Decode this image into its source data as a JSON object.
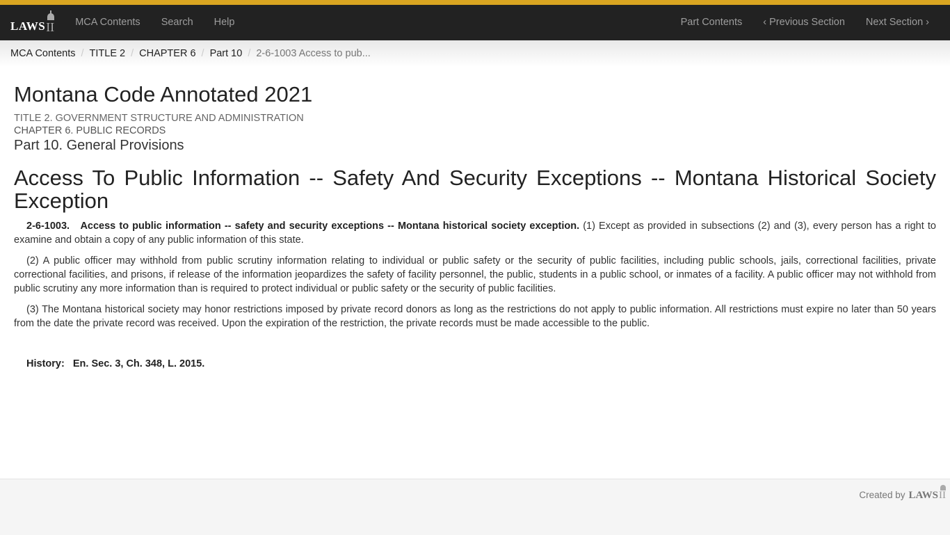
{
  "colors": {
    "accent": "#d9a521",
    "navbar": "#222222"
  },
  "navbar": {
    "logo": "LAWS",
    "left_links": [
      "MCA Contents",
      "Search",
      "Help"
    ],
    "right_links": [
      "Part Contents",
      "‹ Previous Section",
      "Next Section ›"
    ]
  },
  "breadcrumb": {
    "items": [
      "MCA Contents",
      "TITLE 2",
      "CHAPTER 6",
      "Part 10"
    ],
    "active": "2-6-1003 Access to pub...",
    "separator": "/"
  },
  "header": {
    "title": "Montana Code Annotated 2021",
    "title_line": "TITLE 2. GOVERNMENT STRUCTURE AND ADMINISTRATION",
    "chapter_line": "CHAPTER 6. PUBLIC RECORDS",
    "part_line": "Part 10. General Provisions"
  },
  "section": {
    "heading": "Access To Public Information -- Safety And Security Exceptions -- Montana Historical Society Exception",
    "number": "2-6-1003.",
    "catchline": "Access to public information -- safety and security exceptions -- Montana historical society exception.",
    "p1": " (1) Except as provided in subsections (2) and (3), every person has a right to examine and obtain a copy of any public information of this state.",
    "p2": "(2)   A public officer may withhold from public scrutiny information relating to individual or public safety or the security of public facilities, including public schools, jails, correctional facilities, private correctional facilities, and prisons, if release of the information jeopardizes the safety of facility personnel, the public, students in a public school, or inmates of a facility. A public officer may not withhold from public scrutiny any more information than is required to protect individual or public safety or the security of public facilities.",
    "p3": "(3)   The Montana historical society may honor restrictions imposed by private record donors as long as the restrictions do not apply to public information. All restrictions must expire no later than 50 years from the date the private record was received. Upon the expiration of the restriction, the private records must be made accessible to the public.",
    "history_label": "History:",
    "history_value": "En. Sec. 3, Ch. 348, L. 2015."
  },
  "footer": {
    "text": "Created by",
    "logo": "LAWS"
  }
}
